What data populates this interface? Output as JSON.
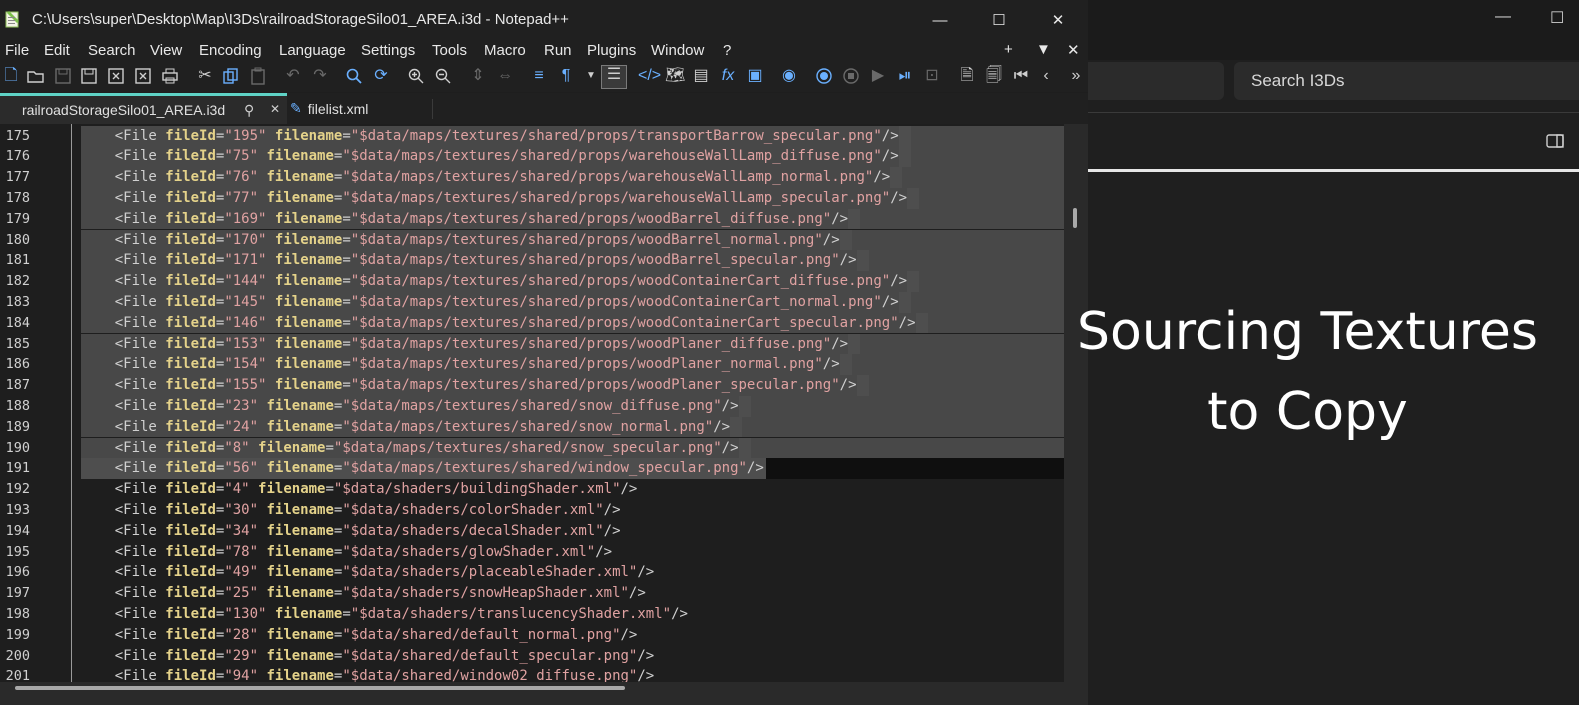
{
  "window": {
    "title": "C:\\Users\\super\\Desktop\\Map\\I3Ds\\railroadStorageSilo01_AREA.i3d - Notepad++",
    "minimize_glyph": "—",
    "maximize_glyph": "☐",
    "close_glyph": "✕"
  },
  "menu": [
    "File",
    "Edit",
    "Search",
    "View",
    "Encoding",
    "Language",
    "Settings",
    "Tools",
    "Macro",
    "Run",
    "Plugins",
    "Window",
    "?"
  ],
  "menu_right": [
    "+",
    "▼",
    "✕"
  ],
  "tabs": [
    {
      "label": "railroadStorageSilo01_AREA.i3d",
      "active": true
    },
    {
      "label": "filelist.xml",
      "active": false
    }
  ],
  "editor": {
    "lines": [
      {
        "n": "175",
        "id": "195",
        "file": "$data/maps/textures/shared/props/transportBarrow_specular.png"
      },
      {
        "n": "176",
        "id": "75",
        "file": "$data/maps/textures/shared/props/warehouseWallLamp_diffuse.png"
      },
      {
        "n": "177",
        "id": "76",
        "file": "$data/maps/textures/shared/props/warehouseWallLamp_normal.png"
      },
      {
        "n": "178",
        "id": "77",
        "file": "$data/maps/textures/shared/props/warehouseWallLamp_specular.png"
      },
      {
        "n": "179",
        "id": "169",
        "file": "$data/maps/textures/shared/props/woodBarrel_diffuse.png"
      },
      {
        "n": "180",
        "id": "170",
        "file": "$data/maps/textures/shared/props/woodBarrel_normal.png"
      },
      {
        "n": "181",
        "id": "171",
        "file": "$data/maps/textures/shared/props/woodBarrel_specular.png"
      },
      {
        "n": "182",
        "id": "144",
        "file": "$data/maps/textures/shared/props/woodContainerCart_diffuse.png"
      },
      {
        "n": "183",
        "id": "145",
        "file": "$data/maps/textures/shared/props/woodContainerCart_normal.png"
      },
      {
        "n": "184",
        "id": "146",
        "file": "$data/maps/textures/shared/props/woodContainerCart_specular.png"
      },
      {
        "n": "185",
        "id": "153",
        "file": "$data/maps/textures/shared/props/woodPlaner_diffuse.png"
      },
      {
        "n": "186",
        "id": "154",
        "file": "$data/maps/textures/shared/props/woodPlaner_normal.png"
      },
      {
        "n": "187",
        "id": "155",
        "file": "$data/maps/textures/shared/props/woodPlaner_specular.png"
      },
      {
        "n": "188",
        "id": "23",
        "file": "$data/maps/textures/shared/snow_diffuse.png"
      },
      {
        "n": "189",
        "id": "24",
        "file": "$data/maps/textures/shared/snow_normal.png"
      },
      {
        "n": "190",
        "id": "8",
        "file": "$data/maps/textures/shared/snow_specular.png"
      },
      {
        "n": "191",
        "id": "56",
        "file": "$data/maps/textures/shared/window_specular.png"
      },
      {
        "n": "192",
        "id": "4",
        "file": "$data/shaders/buildingShader.xml"
      },
      {
        "n": "193",
        "id": "30",
        "file": "$data/shaders/colorShader.xml"
      },
      {
        "n": "194",
        "id": "34",
        "file": "$data/shaders/decalShader.xml"
      },
      {
        "n": "195",
        "id": "78",
        "file": "$data/shaders/glowShader.xml"
      },
      {
        "n": "196",
        "id": "49",
        "file": "$data/shaders/placeableShader.xml"
      },
      {
        "n": "197",
        "id": "25",
        "file": "$data/shaders/snowHeapShader.xml"
      },
      {
        "n": "198",
        "id": "130",
        "file": "$data/shaders/translucencyShader.xml"
      },
      {
        "n": "199",
        "id": "28",
        "file": "$data/shared/default_normal.png"
      },
      {
        "n": "200",
        "id": "29",
        "file": "$data/shared/default_specular.png"
      },
      {
        "n": "201",
        "id": "94",
        "file": "$data/shared/window02_diffuse.png"
      }
    ],
    "selected_range": [
      175,
      191
    ],
    "current_line": "191"
  },
  "right_panel": {
    "search_label": "Search I3Ds",
    "overlay_text": [
      "Sourcing Textures",
      "to Copy"
    ]
  },
  "colors": {
    "tag": "#d0d0d0",
    "attr": "#e4d28a",
    "value": "#e0a2a2",
    "selection": "#484848",
    "accent_tab": "#5fd3c6"
  },
  "icons": [
    "new-file-icon",
    "open-file-icon",
    "save-icon",
    "save-all-icon",
    "close-icon",
    "close-all-icon",
    "print-icon",
    "cut-icon",
    "copy-icon",
    "paste-icon",
    "undo-icon",
    "redo-icon",
    "find-icon",
    "replace-icon",
    "zoom-in-icon",
    "zoom-out-icon",
    "sync-vertical-icon",
    "sync-horizontal-icon",
    "word-wrap-icon",
    "show-all-chars-icon",
    "indent-guide-icon",
    "xml-tag-icon",
    "map-icon",
    "doc-list-icon",
    "function-list-icon",
    "folder-workspace-icon",
    "monitor-icon",
    "record-macro-icon",
    "stop-macro-icon",
    "play-macro-icon",
    "run-macro-icon",
    "save-macro-icon",
    "compare-icon",
    "compare-clear-icon",
    "first-icon",
    "prev-icon",
    "more-icon"
  ]
}
